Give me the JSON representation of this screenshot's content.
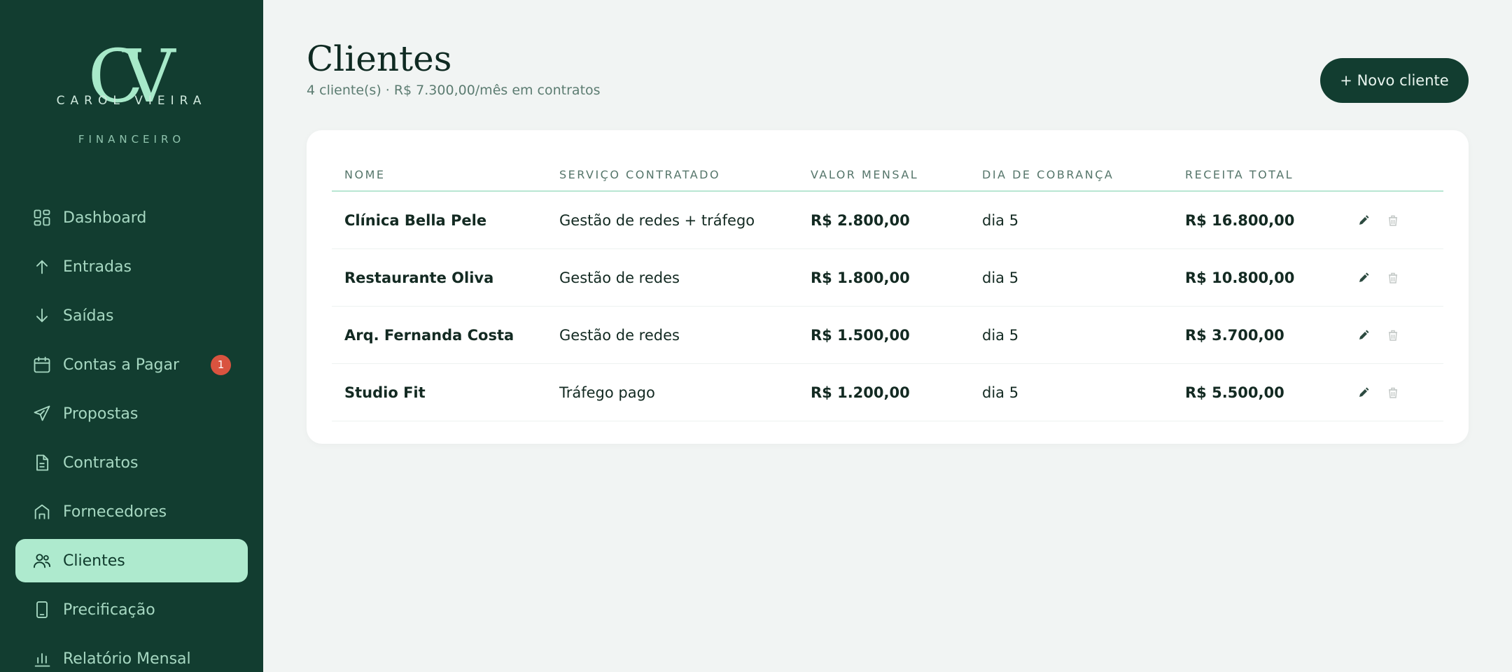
{
  "brand": {
    "monogram": "CV",
    "name": "CAROL VIEIRA",
    "subtitle": "FINANCEIRO",
    "colors": {
      "sidebar": "#123d30",
      "accent": "#aeeace",
      "badge": "#d9533f"
    }
  },
  "nav": {
    "items": [
      {
        "label": "Dashboard",
        "icon": "grid-icon"
      },
      {
        "label": "Entradas",
        "icon": "arrow-up-icon"
      },
      {
        "label": "Saídas",
        "icon": "arrow-down-icon"
      },
      {
        "label": "Contas a Pagar",
        "icon": "calendar-icon",
        "badge": "1"
      },
      {
        "label": "Propostas",
        "icon": "send-icon"
      },
      {
        "label": "Contratos",
        "icon": "document-icon"
      },
      {
        "label": "Fornecedores",
        "icon": "store-icon"
      },
      {
        "label": "Clientes",
        "icon": "users-icon",
        "active": true
      },
      {
        "label": "Precificação",
        "icon": "phone-icon"
      },
      {
        "label": "Relatório Mensal",
        "icon": "bar-chart-icon"
      }
    ]
  },
  "header": {
    "title": "Clientes",
    "subtitle": "4 cliente(s) · R$ 7.300,00/mês em contratos",
    "new_button": "+ Novo cliente"
  },
  "table": {
    "columns": [
      "NOME",
      "SERVIÇO CONTRATADO",
      "VALOR MENSAL",
      "DIA DE COBRANÇA",
      "RECEITA TOTAL"
    ],
    "rows": [
      {
        "name": "Clínica Bella Pele",
        "service": "Gestão de redes + tráfego",
        "monthly": "R$ 2.800,00",
        "billing_day": "dia 5",
        "total": "R$ 16.800,00"
      },
      {
        "name": "Restaurante Oliva",
        "service": "Gestão de redes",
        "monthly": "R$ 1.800,00",
        "billing_day": "dia 5",
        "total": "R$ 10.800,00"
      },
      {
        "name": "Arq. Fernanda Costa",
        "service": "Gestão de redes",
        "monthly": "R$ 1.500,00",
        "billing_day": "dia 5",
        "total": "R$ 3.700,00"
      },
      {
        "name": "Studio Fit",
        "service": "Tráfego pago",
        "monthly": "R$ 1.200,00",
        "billing_day": "dia 5",
        "total": "R$ 5.500,00"
      }
    ],
    "row_actions": [
      "pencil-icon",
      "trash-icon"
    ]
  }
}
